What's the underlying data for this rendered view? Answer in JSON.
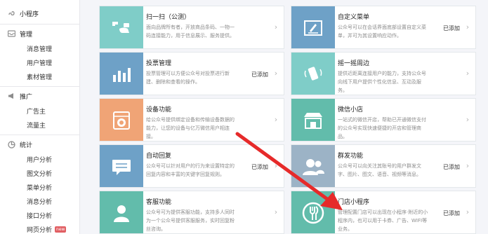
{
  "sidebar": {
    "mini_program": "小程序",
    "manage": {
      "title": "管理",
      "items": [
        "消息管理",
        "用户管理",
        "素材管理"
      ]
    },
    "promote": {
      "title": "推广",
      "items": [
        "广告主",
        "流量主"
      ]
    },
    "stats": {
      "title": "统计",
      "items": [
        "用户分析",
        "图文分析",
        "菜单分析",
        "消息分析",
        "接口分析",
        "网页分析"
      ],
      "new_badge": "new"
    }
  },
  "cards": [
    {
      "title": "扫一扫（公测）",
      "desc": "面向品牌所有者，开放商品条码、一物一码连接能力，用于信息展示、服务提供。",
      "status": "",
      "icon": "qr-scan-icon",
      "color": "#7fcdc8"
    },
    {
      "title": "自定义菜单",
      "desc": "公众号可以在会话界面底部设置自定义菜单，并可为其设置响应动作。",
      "status": "已添加",
      "icon": "pen-icon",
      "color": "#6ea1c7"
    },
    {
      "title": "投票管理",
      "desc": "投票管理可以方便公众号对投票进行新建、删除和查看的操作。",
      "status": "已添加",
      "icon": "bar-chart-icon",
      "color": "#6ea1c7"
    },
    {
      "title": "摇一摇周边",
      "desc": "提供近距离连接用户的能力，支持公众号向线下用户提供个性化信息、互动及服务。",
      "status": "",
      "icon": "shake-phone-icon",
      "color": "#7fcdc8"
    },
    {
      "title": "设备功能",
      "desc": "给公众号提供绑定设备和传输设备数据的能力，让您的设备与亿万微信用户相连接。",
      "status": "",
      "icon": "washing-machine-icon",
      "color": "#f0a476"
    },
    {
      "title": "微信小店",
      "desc": "一站式的微信开店，帮助已开通微信支付的公众号实现快速便捷的开店和管理商品。",
      "status": "",
      "icon": "shop-icon",
      "color": "#62bcab"
    },
    {
      "title": "自动回复",
      "desc": "公众号可以针对用户的行为来设置特定的回复内容和丰富的关键字回复规则。",
      "status": "已添加",
      "icon": "chat-bubble-icon",
      "color": "#6ea1c7"
    },
    {
      "title": "群发功能",
      "desc": "公众号可以向关注其账号的用户群发文字、图片、图文、语音、视频等消息。",
      "status": "已添加",
      "icon": "group-users-icon",
      "color": "#9cb3c6"
    },
    {
      "title": "客服功能",
      "desc": "公众号可为提供客服功能，支持多人同时为一个公众号提供客服服务，实时回复粉丝咨询。",
      "status": "",
      "icon": "customer-service-icon",
      "color": "#62bcab"
    },
    {
      "title": "门店小程序",
      "desc": "管理配置门店可以出现在小程序·附近的小程序内，也可以用于卡券、广告、WIFI等业务。",
      "status": "已添加",
      "icon": "fork-icon",
      "color": "#62bcab"
    }
  ]
}
